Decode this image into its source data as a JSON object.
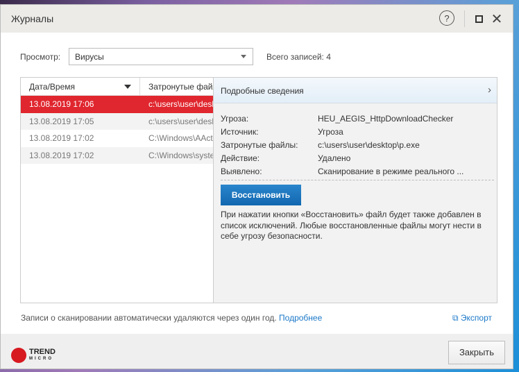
{
  "window": {
    "title": "Журналы",
    "help_icon": "?"
  },
  "view": {
    "label": "Просмотр:",
    "value": "Вирусы",
    "total": "Всего записей: 4"
  },
  "table": {
    "headers": [
      "Дата/Время",
      "Затронутые файлы"
    ],
    "rows": [
      [
        "13.08.2019 17:06",
        "c:\\users\\user\\desktop\\p.exe"
      ],
      [
        "13.08.2019 17:05",
        "c:\\users\\user\\desktop"
      ],
      [
        "13.08.2019 17:02",
        "C:\\Windows\\AAct"
      ],
      [
        "13.08.2019 17:02",
        "C:\\Windows\\system"
      ]
    ]
  },
  "detail": {
    "title": "Подробные сведения",
    "fields": [
      {
        "k": "Угроза:",
        "v": "HEU_AEGIS_HttpDownloadChecker"
      },
      {
        "k": "Источник:",
        "v": "Угроза"
      },
      {
        "k": "Затронутые файлы:",
        "v": "c:\\users\\user\\desktop\\p.exe"
      },
      {
        "k": "Действие:",
        "v": "Удалено"
      },
      {
        "k": "Выявлено:",
        "v": "Сканирование в режиме реального ..."
      }
    ],
    "restore": "Восстановить",
    "note": "При нажатии кнопки «Восстановить» файл будет также добавлен в список исключений. Любые восстановленные файлы могут нести в себе угрозу безопасности."
  },
  "footer": {
    "info": "Записи о сканировании автоматически удаляются через один год.",
    "more": "Подробнее",
    "export": "Экспорт",
    "close": "Закрыть",
    "logo_top": "TREND",
    "logo_bottom": "MICRO"
  }
}
